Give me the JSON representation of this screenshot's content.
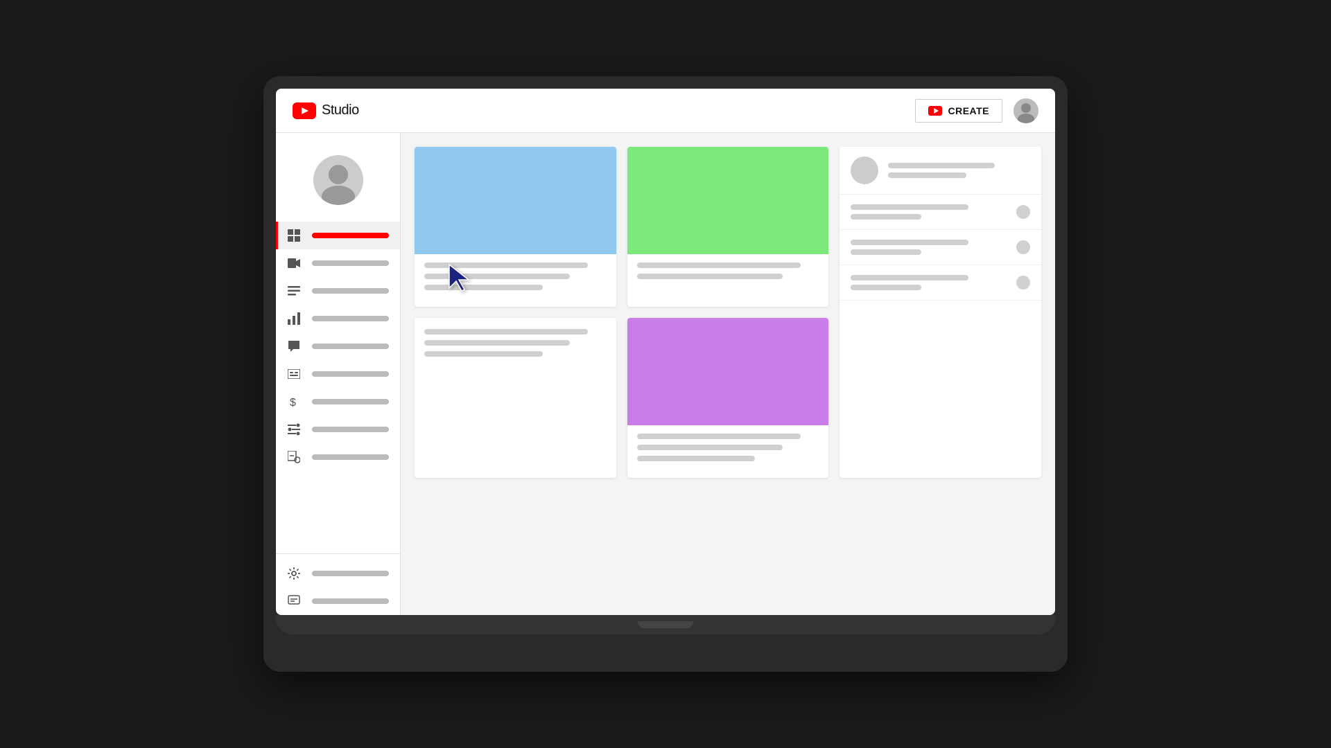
{
  "app": {
    "title": "YouTube Studio",
    "studio_label": "Studio"
  },
  "topbar": {
    "create_label": "CREATE",
    "create_icon": "video-camera-icon",
    "avatar_icon": "user-avatar-icon"
  },
  "sidebar": {
    "items": [
      {
        "id": "dashboard",
        "icon": "dashboard-icon",
        "active": true
      },
      {
        "id": "content",
        "icon": "video-icon",
        "active": false
      },
      {
        "id": "playlists",
        "icon": "playlist-icon",
        "active": false
      },
      {
        "id": "analytics",
        "icon": "analytics-icon",
        "active": false
      },
      {
        "id": "comments",
        "icon": "comments-icon",
        "active": false
      },
      {
        "id": "subtitles",
        "icon": "subtitles-icon",
        "active": false
      },
      {
        "id": "monetization",
        "icon": "dollar-icon",
        "active": false
      },
      {
        "id": "customization",
        "icon": "customization-icon",
        "active": false
      },
      {
        "id": "audiolib",
        "icon": "audio-icon",
        "active": false
      }
    ],
    "bottom_items": [
      {
        "id": "settings",
        "icon": "settings-icon"
      },
      {
        "id": "feedback",
        "icon": "feedback-icon"
      }
    ]
  },
  "content": {
    "cards": [
      {
        "id": "card1",
        "thumbnail_color": "blue",
        "has_cursor": true
      },
      {
        "id": "card2",
        "thumbnail_color": "green",
        "has_cursor": false
      },
      {
        "id": "card3",
        "type": "list",
        "has_cursor": false
      },
      {
        "id": "card4",
        "type": "text",
        "has_cursor": false
      },
      {
        "id": "card5",
        "thumbnail_color": "purple",
        "has_cursor": false
      }
    ]
  },
  "colors": {
    "red": "#ff0000",
    "blue_thumbnail": "#90c8f0",
    "green_thumbnail": "#7be87b",
    "purple_thumbnail": "#c87de8",
    "line_color": "#d0d0d0",
    "active_bar": "#ff0000",
    "bg_content": "#f4f4f4"
  }
}
